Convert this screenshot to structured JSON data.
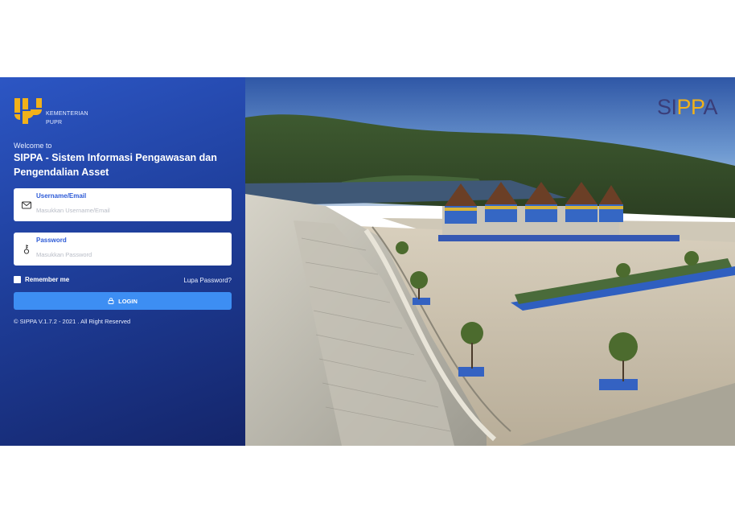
{
  "brand": {
    "ministry_line1": "KEMENTERIAN",
    "ministry_line2": "PUPR",
    "app_logo_text_a": "SI",
    "app_logo_text_b": "PP",
    "app_logo_text_c": "A"
  },
  "login": {
    "welcome": "Welcome to",
    "title": "SIPPA - Sistem Informasi Pengawasan dan Pengendalian Asset",
    "username_label": "Username/Email",
    "username_placeholder": "Masukkan Username/Email",
    "password_label": "Password",
    "password_placeholder": "Masukkan Password",
    "remember_label": "Remember me",
    "forgot_label": "Lupa Password?",
    "login_label": "LOGIN",
    "copyright": "© SIPPA V.1.7.2 - 2021 . All Right Reserved"
  },
  "icons": {
    "username": "envelope-icon",
    "password": "key-icon",
    "login": "lock-icon"
  },
  "colors": {
    "panel": "#2346a8",
    "accent": "#3d8ef3",
    "label": "#2d5bd7",
    "logo_yellow": "#f1b11a"
  }
}
